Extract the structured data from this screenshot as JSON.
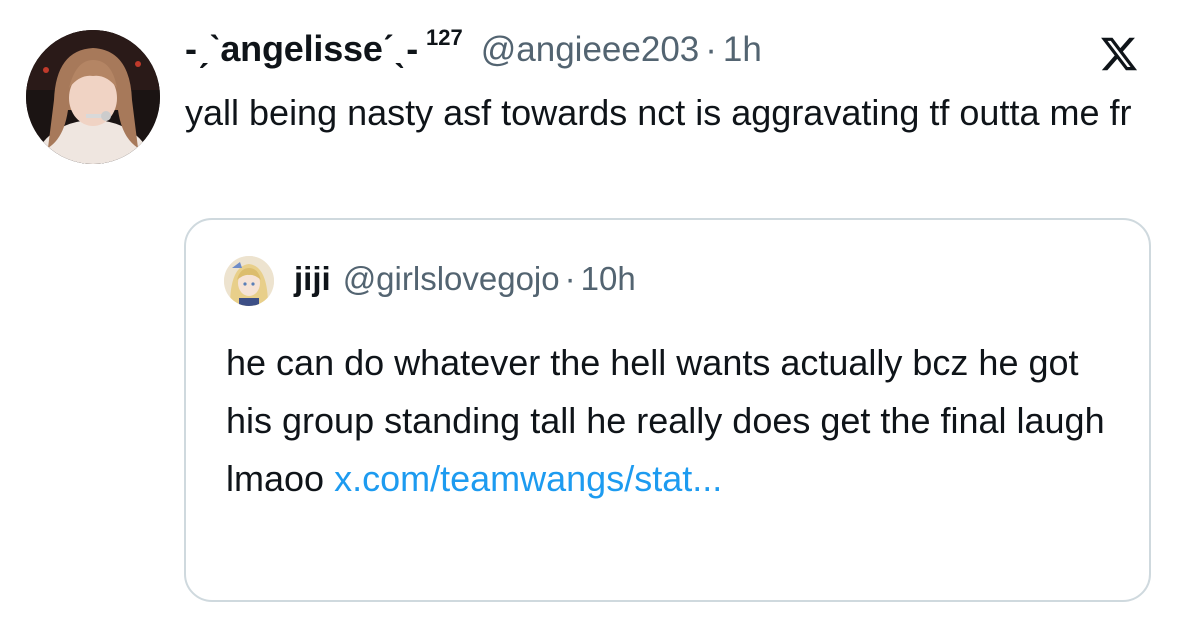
{
  "tweet": {
    "display_name": "-ˏˋangelisseˊˎ-",
    "name_suffix": "127",
    "handle": "@angieee203",
    "separator": "·",
    "time": "1h",
    "text": "yall being nasty asf towards nct is aggravating tf outta me fr",
    "avatar_icon": "profile-photo"
  },
  "platform_icon": "x-logo-icon",
  "quote": {
    "display_name": "jiji",
    "handle": "@girlslovegojo",
    "separator": "·",
    "time": "10h",
    "text": "he can do whatever the hell wants actually bcz he got his group standing tall he really does get the final laugh lmaoo",
    "link_text": "x.com/teamwangs/stat...",
    "link_color": "#1d9bf0",
    "avatar_icon": "anime-avatar"
  },
  "colors": {
    "text_primary": "#0f1419",
    "text_secondary": "#536471",
    "border": "#cfd9de",
    "link": "#1d9bf0"
  }
}
